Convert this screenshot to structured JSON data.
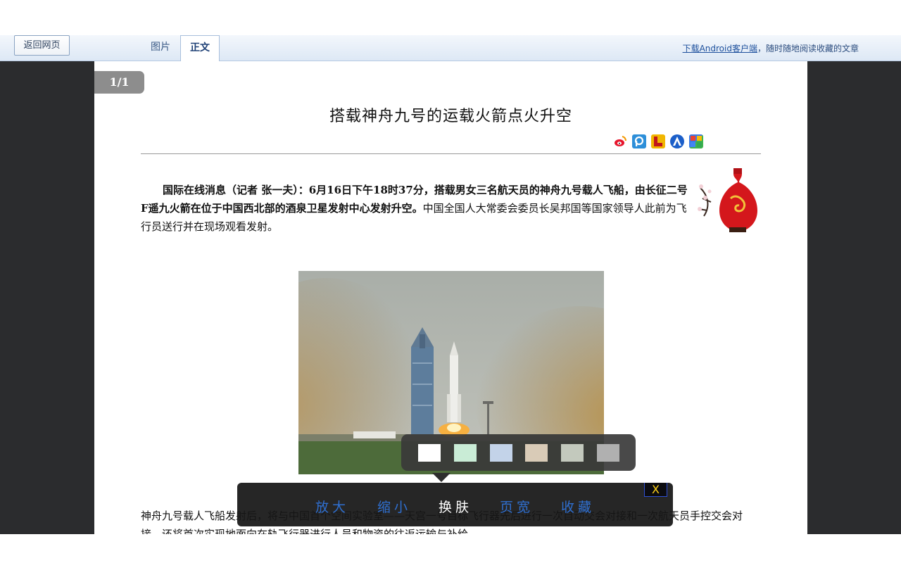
{
  "toolbar": {
    "back_label": "返回网页",
    "tabs": [
      {
        "label": "图片"
      },
      {
        "label": "正文"
      }
    ],
    "promo_link": "下载Android客户端",
    "promo_rest": "，随时随地阅读收藏的文章"
  },
  "page": {
    "counter": "1/1",
    "title": "搭载神舟九号的运载火箭点火升空",
    "share_icons": [
      "weibo-icon",
      "pengyou-icon",
      "renren-icon",
      "kaixin-icon",
      "google-icon"
    ],
    "lead_bold": "国际在线消息（记者 张一夫）：6月16日下午18时37分，搭载男女三名航天员的神舟九号载人飞船，由长征二号F遥九火箭在位于中国西北部的酒泉卫星发射中心发射升空。",
    "lead_rest": "中国全国人大常委会委员长吴邦国等国家领导人此前为飞行员送行并在现场观看发射。",
    "body": "神舟九号载人飞船发射后，将与中国首个空间实验室——天宫一号目标飞行器先后进行一次自动交会对接和一次航天员手控交会对接，还将首次实现地面向在轨飞行器进行人员和物资的往返运输与补给。"
  },
  "skins": {
    "colors": [
      "#ffffff",
      "#c9ecd6",
      "#c3d3e9",
      "#d9cbb7",
      "#c3c9bd",
      "#b0b0b0"
    ]
  },
  "menu": {
    "items": [
      {
        "label": "放大"
      },
      {
        "label": "缩小"
      },
      {
        "label": "换肤"
      },
      {
        "label": "页宽"
      },
      {
        "label": "收藏"
      }
    ],
    "close_label": "X"
  }
}
